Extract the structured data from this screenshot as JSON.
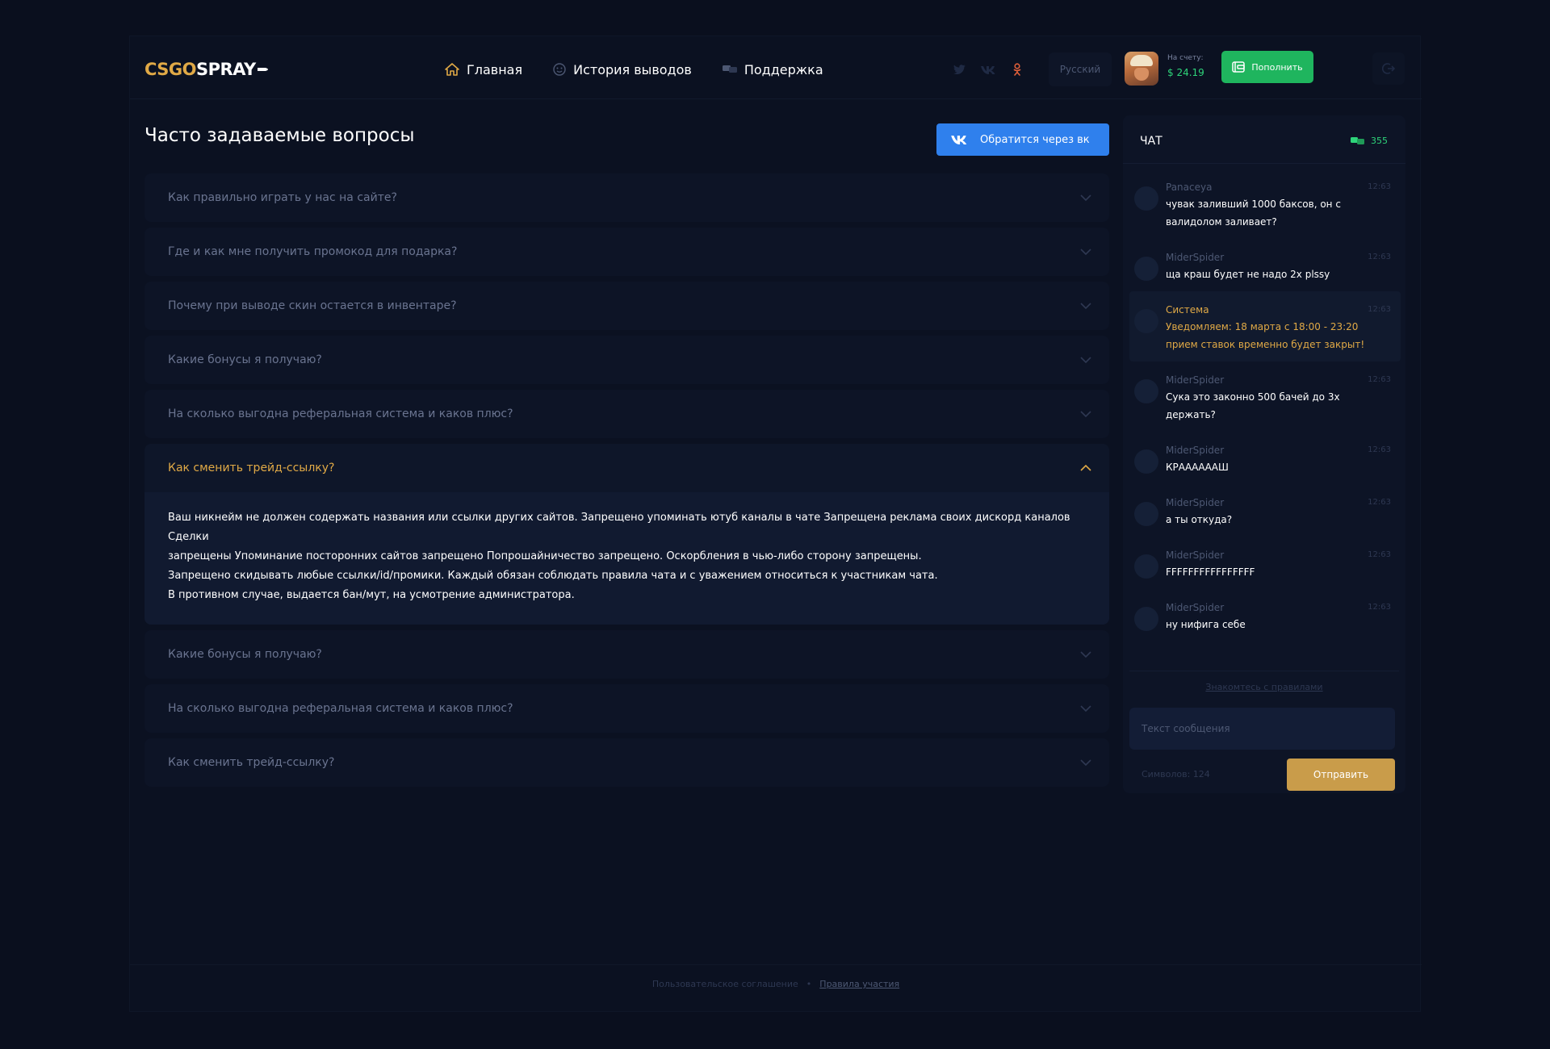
{
  "header": {
    "logo_part1": "CSGO",
    "logo_part2": "SPRAY",
    "nav": [
      {
        "label": "Главная",
        "icon": "home-icon"
      },
      {
        "label": "История выводов",
        "icon": "smile-icon"
      },
      {
        "label": "Поддержка",
        "icon": "chat-icon"
      }
    ],
    "social": [
      "twitter-icon",
      "vk-icon",
      "odnoklassniki-icon"
    ],
    "language": "Русский",
    "balance_label": "На счету:",
    "balance_value": "$ 24.19",
    "topup_label": "Пополнить"
  },
  "main": {
    "title": "Часто задаваемые вопросы",
    "vk_button": "Обратится через вк",
    "faq": [
      {
        "q": "Как правильно играть у нас на сайте?"
      },
      {
        "q": "Где и как мне получить промокод для подарка?"
      },
      {
        "q": "Почему при выводе скин остается в инвентаре?"
      },
      {
        "q": "Какие бонусы я получаю?"
      },
      {
        "q": "На сколько выгодна реферальная система и каков плюс?"
      },
      {
        "q": "Как сменить трейд-ссылку?",
        "open": true,
        "answer": [
          "Ваш никнейм не должен содержать названия или ссылки других сайтов. Запрещено упоминать ютуб каналы в чате Запрещена реклама своих дискорд каналов Сделки",
          "запрещены Упоминание посторонних сайтов запрещено Попрошайничество запрещено. Оскорбления в чью-либо сторону запрещены.",
          "Запрещено скидывать любые ссылки/id/промики. Каждый обязан соблюдать правила чата и с уважением относиться к участникам чата.",
          "В противном случае, выдается бан/мут, на усмотрение администратора."
        ]
      },
      {
        "q": "Какие бонусы я получаю?"
      },
      {
        "q": "На сколько выгодна реферальная система и каков плюс?"
      },
      {
        "q": "Как сменить трейд-ссылку?"
      }
    ]
  },
  "chat": {
    "title": "ЧАТ",
    "online": "355",
    "messages": [
      {
        "name": "Panaceya",
        "time": "12:63",
        "text": "чувак заливший 1000 баксов, он с валидолом заливает?"
      },
      {
        "name": "MiderSpider",
        "time": "12:63",
        "text": "ща краш будет не надо 2х plssy"
      },
      {
        "name": "Система",
        "time": "12:63",
        "text": "Уведомляем: 18 марта с 18:00 - 23:20 прием ставок временно будет закрыт!",
        "system": true
      },
      {
        "name": "MiderSpider",
        "time": "12:63",
        "text": "Сука это законно 500 бачей до 3х держать?"
      },
      {
        "name": "MiderSpider",
        "time": "12:63",
        "text": "КРААААААШ"
      },
      {
        "name": "MiderSpider",
        "time": "12:63",
        "text": "а ты откуда?"
      },
      {
        "name": "MiderSpider",
        "time": "12:63",
        "text": "FFFFFFFFFFFFFFFF"
      },
      {
        "name": "MiderSpider",
        "time": "12:63",
        "text": "ну нифига себе"
      }
    ],
    "rules_link": "Знакомтесь с правилами",
    "input_placeholder": "Текст сообщения",
    "chars_left": "Символов: 124",
    "send_label": "Отправить"
  },
  "footer": {
    "agreement": "Пользовательское соглашение",
    "separator": "•",
    "rules": "Правила участия"
  },
  "colors": {
    "background": "#0a0f1e",
    "accent_gold": "#e0a946",
    "accent_green": "#1fb55e",
    "vk_blue": "#2f80ed"
  }
}
